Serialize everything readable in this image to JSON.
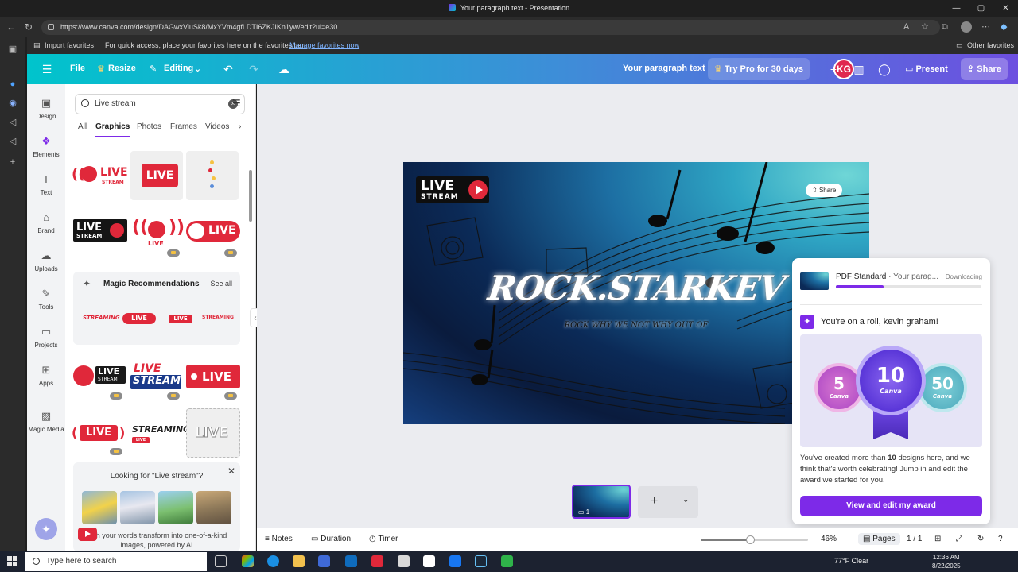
{
  "window": {
    "title": "Your paragraph text - Presentation",
    "controls": [
      "—",
      "▢",
      "✕"
    ]
  },
  "browser": {
    "url": "https://www.canva.com/design/DAGwxViuSk8/MxYVm4gfLDTI6ZKJIKn1yw/edit?ui=e30",
    "favorites": {
      "import_label": "Import favorites",
      "tip": "For quick access, place your favorites here on the favorites bar.",
      "manage_link": "Manage favorites now",
      "other_label": "Other favorites"
    }
  },
  "canva_top": {
    "file": "File",
    "resize": "Resize",
    "editing": "Editing",
    "doc_title": "Your paragraph text",
    "try_pro": "Try Pro for 30 days",
    "avatar_initials": "KG",
    "present": "Present",
    "share": "Share"
  },
  "rail": [
    {
      "label": "Design",
      "icon": "design-icon"
    },
    {
      "label": "Elements",
      "icon": "elements-icon",
      "active": true
    },
    {
      "label": "Text",
      "icon": "text-icon"
    },
    {
      "label": "Brand",
      "icon": "brand-icon"
    },
    {
      "label": "Uploads",
      "icon": "uploads-icon"
    },
    {
      "label": "Tools",
      "icon": "tools-icon"
    },
    {
      "label": "Projects",
      "icon": "projects-icon"
    },
    {
      "label": "Apps",
      "icon": "apps-icon"
    },
    {
      "label": "Magic Media",
      "icon": "magic-media-icon"
    }
  ],
  "panel": {
    "search_value": "Live stream",
    "tabs": [
      "All",
      "Graphics",
      "Photos",
      "Frames",
      "Videos"
    ],
    "active_tab": "Graphics",
    "graphics_text": {
      "live": "LIVE",
      "stream": "STREAM",
      "streaming": "STREAMING"
    },
    "magic_recommendations": {
      "title": "Magic Recommendations",
      "see_all": "See all"
    },
    "looking_for": {
      "question": "Looking for \"Live stream\"?",
      "desc": "...ch your words transform into one-of-a-kind images, powered by AI"
    }
  },
  "slide": {
    "logo_live": "LIVE",
    "logo_stream": "STREAM",
    "title": "ROCK.STARKEV",
    "subtitle": "ROCK WHY WE NOT WHY OUT OF",
    "share_chip": "Share"
  },
  "pages": {
    "thumb_number": "1"
  },
  "download_popup": {
    "file_type": "PDF Standard",
    "file_name": " · Your parag...",
    "status": "Downloading",
    "progress": 0.33,
    "roll_title": "You're on a roll, kevin graham!",
    "badges": [
      "5",
      "10",
      "50"
    ],
    "badge_brand": "Canva",
    "message_pre": "You've created more than ",
    "message_count": "10",
    "message_post": " designs here, and we think that's worth celebrating! Jump in and edit the award we started for you.",
    "cta": "View and edit my award"
  },
  "bottom_bar": {
    "notes": "Notes",
    "duration": "Duration",
    "timer": "Timer",
    "zoom": "46%",
    "zoom_fraction": 0.46,
    "pages_label": "Pages",
    "page_count": "1 / 1"
  },
  "taskbar": {
    "search_placeholder": "Type here to search",
    "weather": "77°F  Clear",
    "time": "12:36 AM",
    "date": "8/22/2025"
  },
  "colors": {
    "accent": "#7d2ae8",
    "live_red": "#e0283a",
    "top_gradient_start": "#00c4cc",
    "top_gradient_end": "#6d4fe0"
  }
}
